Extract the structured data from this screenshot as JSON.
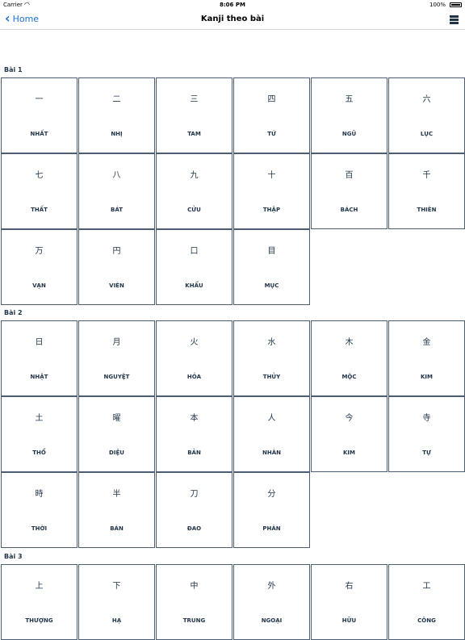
{
  "status": {
    "carrier": "Carrier",
    "time": "8:06 PM",
    "battery": "100%"
  },
  "nav": {
    "back_label": "Home",
    "title": "Kanji theo bài"
  },
  "sections": [
    {
      "title": "Bài 1",
      "cards": [
        {
          "kanji": "一",
          "reading": "NHẤT"
        },
        {
          "kanji": "二",
          "reading": "NHỊ"
        },
        {
          "kanji": "三",
          "reading": "TAM"
        },
        {
          "kanji": "四",
          "reading": "TỨ"
        },
        {
          "kanji": "五",
          "reading": "NGŨ"
        },
        {
          "kanji": "六",
          "reading": "LỤC"
        },
        {
          "kanji": "七",
          "reading": "THẤT"
        },
        {
          "kanji": "八",
          "reading": "BÁT"
        },
        {
          "kanji": "九",
          "reading": "CỬU"
        },
        {
          "kanji": "十",
          "reading": "THẬP"
        },
        {
          "kanji": "百",
          "reading": "BÁCH"
        },
        {
          "kanji": "千",
          "reading": "THIÊN"
        },
        {
          "kanji": "万",
          "reading": "VẠN"
        },
        {
          "kanji": "円",
          "reading": "VIÊN"
        },
        {
          "kanji": "口",
          "reading": "KHẨU"
        },
        {
          "kanji": "目",
          "reading": "MỤC"
        }
      ]
    },
    {
      "title": "Bài 2",
      "cards": [
        {
          "kanji": "日",
          "reading": "NHẬT"
        },
        {
          "kanji": "月",
          "reading": "NGUYỆT"
        },
        {
          "kanji": "火",
          "reading": "HỎA"
        },
        {
          "kanji": "水",
          "reading": "THỦY"
        },
        {
          "kanji": "木",
          "reading": "MỘC"
        },
        {
          "kanji": "金",
          "reading": "KIM"
        },
        {
          "kanji": "土",
          "reading": "THỔ"
        },
        {
          "kanji": "曜",
          "reading": "DIỆU"
        },
        {
          "kanji": "本",
          "reading": "BẢN"
        },
        {
          "kanji": "人",
          "reading": "NHÂN"
        },
        {
          "kanji": "今",
          "reading": "KIM"
        },
        {
          "kanji": "寺",
          "reading": "TỰ"
        },
        {
          "kanji": "時",
          "reading": "THỜI"
        },
        {
          "kanji": "半",
          "reading": "BÁN"
        },
        {
          "kanji": "刀",
          "reading": "ĐAO"
        },
        {
          "kanji": "分",
          "reading": "PHÂN"
        }
      ]
    },
    {
      "title": "Bài 3",
      "cards": [
        {
          "kanji": "上",
          "reading": "THƯỢNG"
        },
        {
          "kanji": "下",
          "reading": "HẠ"
        },
        {
          "kanji": "中",
          "reading": "TRUNG"
        },
        {
          "kanji": "外",
          "reading": "NGOẠI"
        },
        {
          "kanji": "右",
          "reading": "HỮU"
        },
        {
          "kanji": "工",
          "reading": "CÔNG"
        }
      ]
    }
  ]
}
